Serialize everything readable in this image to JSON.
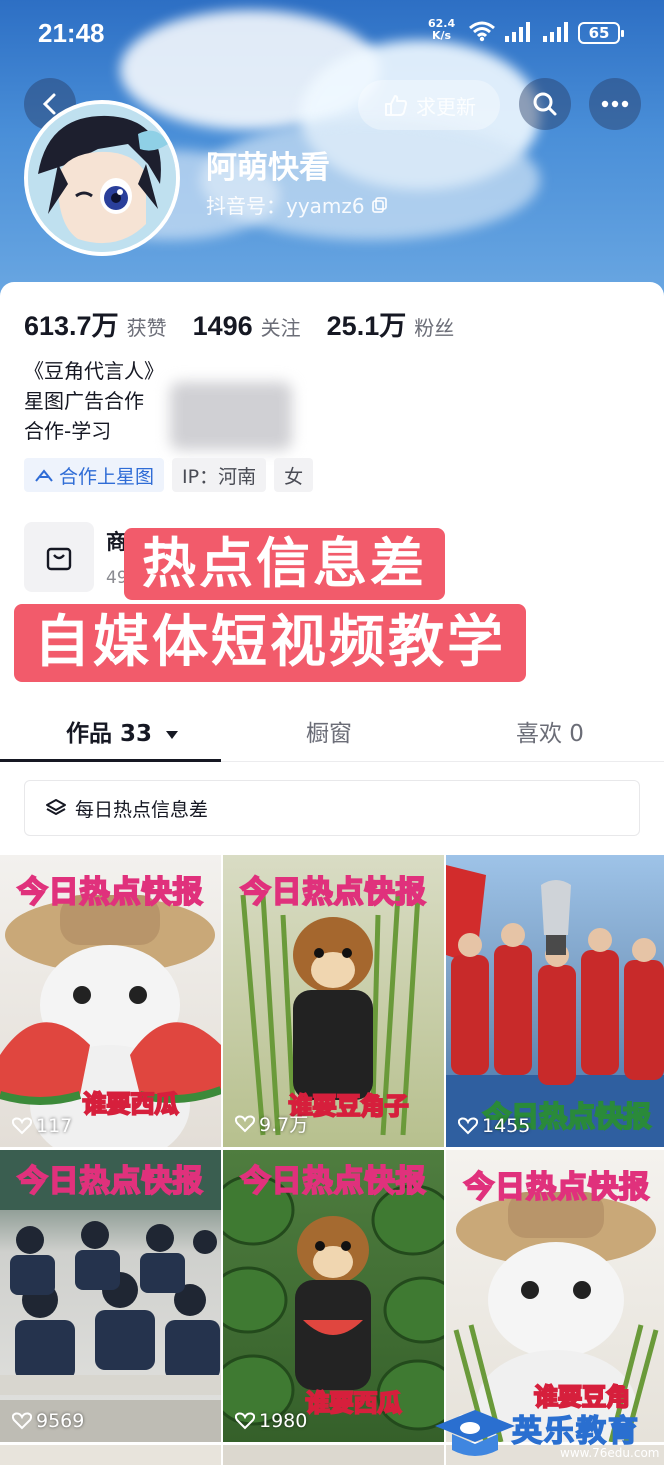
{
  "status_bar": {
    "time": "21:48",
    "net_speed": "62.4",
    "net_unit": "K/s",
    "wifi_icon": "wifi-icon",
    "battery": "65"
  },
  "header": {
    "update_button": "求更新",
    "name": "阿萌快看",
    "douyin_id": "抖音号：yyamz6"
  },
  "stats": [
    {
      "value": "613.7万",
      "label": "获赞"
    },
    {
      "value": "1496",
      "label": "关注"
    },
    {
      "value": "25.1万",
      "label": "粉丝"
    }
  ],
  "bio": {
    "line1": "《豆角代言人》",
    "line2": "星图广告合作",
    "line3": "合作-学习"
  },
  "tags": {
    "xingtu": "合作上星图",
    "ip": "IP：河南",
    "gender": "女"
  },
  "shop": {
    "title": "商",
    "subtitle": "49"
  },
  "overlay": {
    "line1": "热点信息差",
    "line2": "自媒体短视频教学"
  },
  "tabs": {
    "works": "作品 33",
    "window": "橱窗",
    "likes": "喜欢 0"
  },
  "collection": {
    "label": "每日热点信息差"
  },
  "videos": [
    {
      "title": "今日热点快报",
      "caption": "谁要西瓜",
      "likes": "117",
      "scene": "cat-watermelon"
    },
    {
      "title": "今日热点快报",
      "caption": "谁要豆角子",
      "likes": "9.7万",
      "scene": "puppy-beans"
    },
    {
      "title": "",
      "caption": "今日热点快报",
      "likes": "1455",
      "scene": "football-team"
    },
    {
      "title": "今日热点快报",
      "caption": "",
      "likes": "9569",
      "scene": "classroom-exam"
    },
    {
      "title": "今日热点快报",
      "caption": "谁要西瓜",
      "likes": "1980",
      "scene": "puppy-watermelons"
    },
    {
      "title": "今日热点快报",
      "caption": "谁要豆角",
      "likes": "",
      "scene": "cat-beans"
    }
  ],
  "watermark": {
    "text": "英乐教育",
    "url": "www.76edu.com"
  },
  "colors": {
    "accent": "#f25b6b",
    "sky": "#3f84d2",
    "title_stroke": "#e0317c"
  }
}
